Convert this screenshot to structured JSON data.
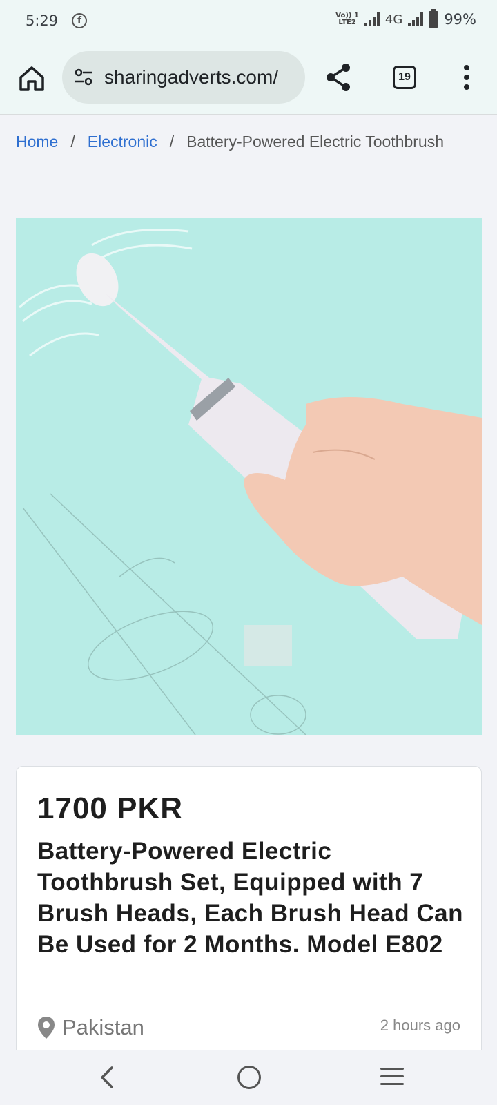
{
  "status_bar": {
    "time": "5:29",
    "network_type": "4G",
    "volte_label_top": "Vo)) 1",
    "volte_label_bottom": "LTE2",
    "battery": "99%"
  },
  "browser": {
    "url": "sharingadverts.com/",
    "tab_count": "19",
    "icons": {
      "home": "home-icon",
      "site_settings": "tune-icon",
      "share": "share-icon",
      "tabs": "tabs-icon",
      "menu": "more-vert-icon"
    }
  },
  "breadcrumb": {
    "home": "Home",
    "separator": "/",
    "category": "Electronic",
    "current": "Battery-Powered Electric Toothbrush"
  },
  "product": {
    "image_alt": "electric-toothbrush-photo",
    "price": "1700 PKR",
    "title": "Battery-Powered Electric Toothbrush Set, Equipped with 7 Brush Heads, Each Brush Head Can Be Used for 2 Months. Model E802",
    "location": "Pakistan",
    "posted": "2 hours ago"
  },
  "colors": {
    "link": "#2f6fd0",
    "image_bg": "#b8ece6",
    "toolbar_bg": "#eef7f6",
    "page_bg": "#f2f3f7"
  },
  "nav_bar": {
    "icons": [
      "back-icon",
      "home-circle-icon",
      "recents-icon"
    ]
  }
}
